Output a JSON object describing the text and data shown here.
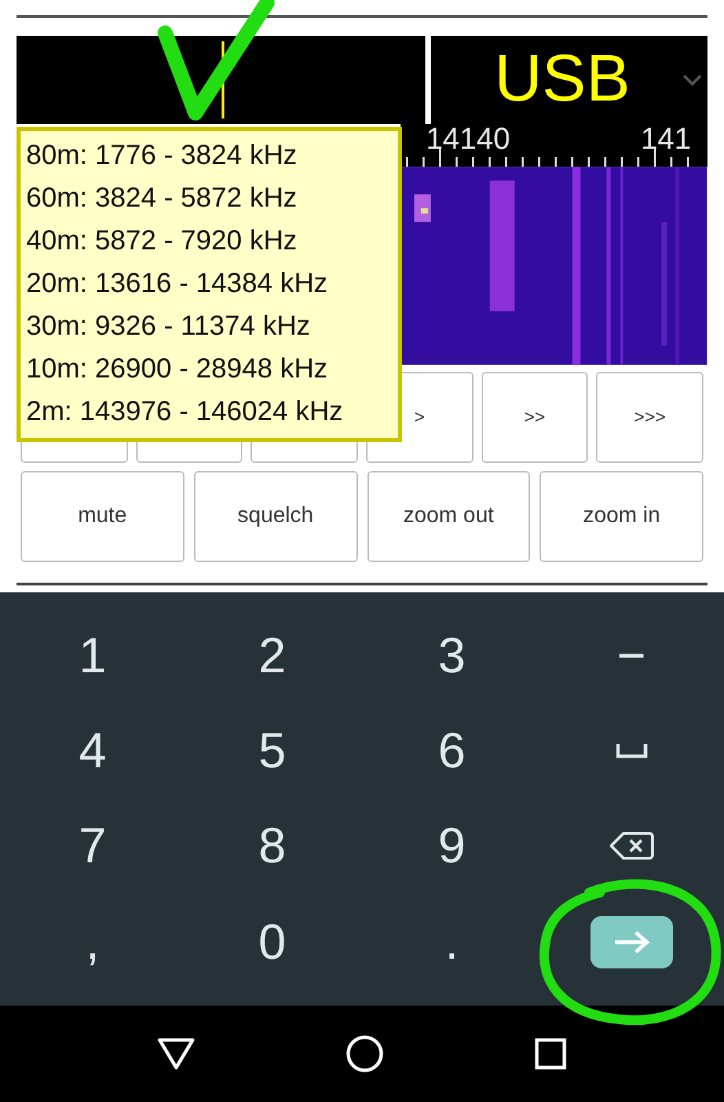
{
  "display": {
    "frequency_cursor": true,
    "mode": "USB"
  },
  "ruler": {
    "labels": [
      "14140",
      "141"
    ]
  },
  "band_popup": {
    "items": [
      "80m: 1776 - 3824 kHz",
      "60m: 3824 - 5872 kHz",
      "40m: 5872 - 7920 kHz",
      "20m: 13616 - 14384 kHz",
      "30m: 9326 - 11374 kHz",
      "10m: 26900 - 28948 kHz",
      "2m: 143976 - 146024 kHz"
    ]
  },
  "tuning_buttons": [
    ">",
    ">>",
    ">>>"
  ],
  "control_buttons": [
    "mute",
    "squelch",
    "zoom out",
    "zoom in"
  ],
  "keyboard": [
    {
      "kind": "char",
      "label": "1"
    },
    {
      "kind": "char",
      "label": "2"
    },
    {
      "kind": "char",
      "label": "3"
    },
    {
      "kind": "char",
      "label": "−"
    },
    {
      "kind": "char",
      "label": "4"
    },
    {
      "kind": "char",
      "label": "5"
    },
    {
      "kind": "char",
      "label": "6"
    },
    {
      "kind": "space"
    },
    {
      "kind": "char",
      "label": "7"
    },
    {
      "kind": "char",
      "label": "8"
    },
    {
      "kind": "char",
      "label": "9"
    },
    {
      "kind": "backspace"
    },
    {
      "kind": "char",
      "label": ","
    },
    {
      "kind": "char",
      "label": "0"
    },
    {
      "kind": "char",
      "label": "."
    },
    {
      "kind": "enter"
    }
  ]
}
